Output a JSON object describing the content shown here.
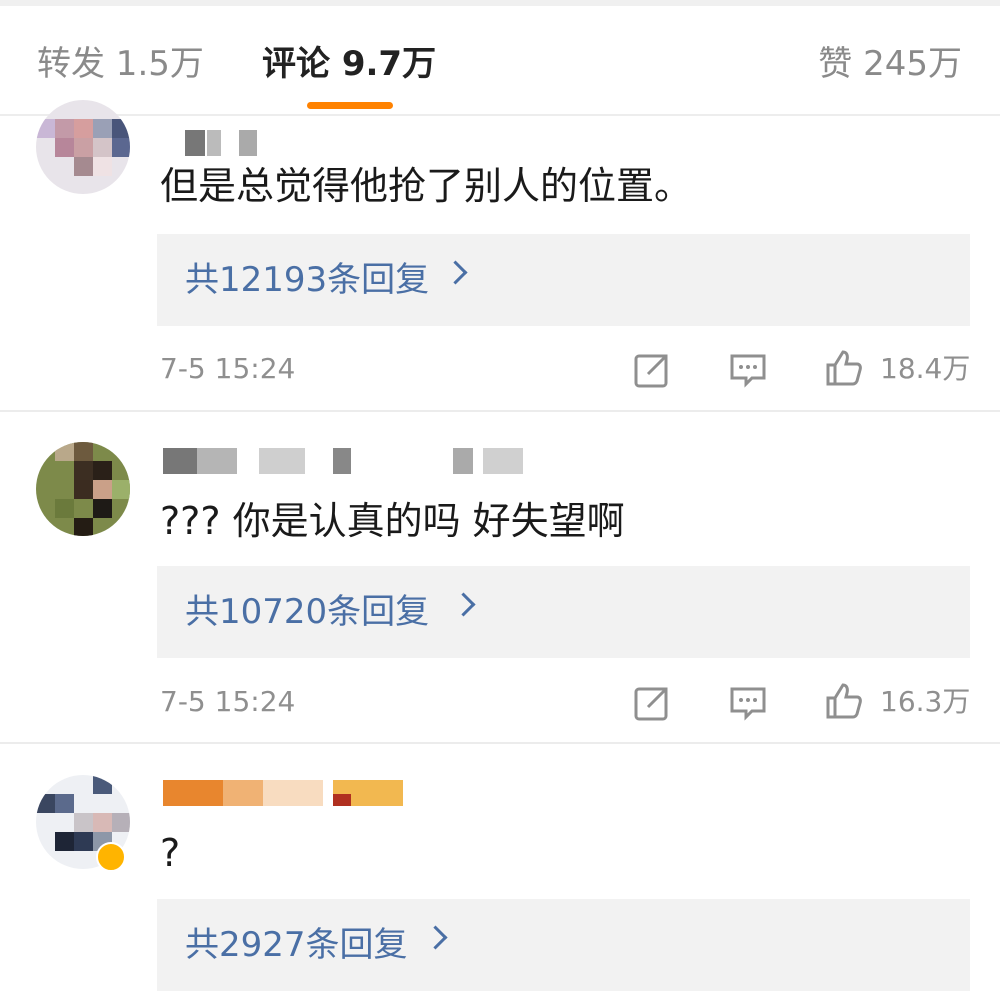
{
  "tabs": {
    "repost": "转发 1.5万",
    "comments": "评论 9.7万",
    "likes": "赞 245万"
  },
  "colors": {
    "accent": "#ff8200",
    "link": "#4a6fa5",
    "muted": "#8f8f8f"
  },
  "comments": [
    {
      "text": "但是总觉得他抢了别人的位置。",
      "replies": "共12193条回复",
      "time": "7-5 15:24",
      "likes": "18.4万"
    },
    {
      "text": "??? 你是认真的吗 好失望啊",
      "replies": "共10720条回复",
      "time": "7-5 15:24",
      "likes": "16.3万"
    },
    {
      "text": "?",
      "replies": "共2927条回复"
    }
  ],
  "icons": {
    "share": "share-icon",
    "comment": "comment-icon",
    "like": "thumbs-up-icon",
    "reply_chevron": "chevron-right-icon"
  }
}
